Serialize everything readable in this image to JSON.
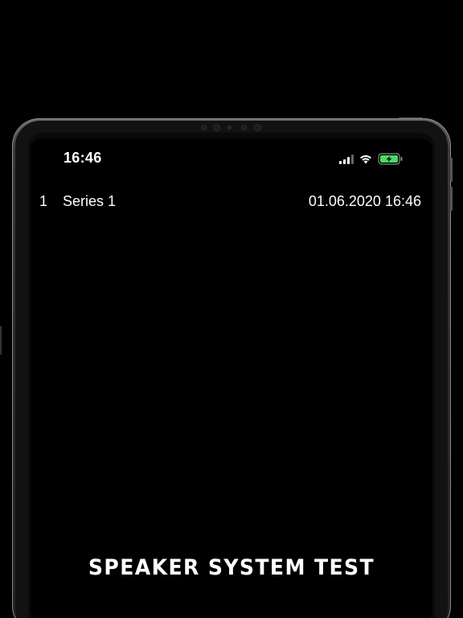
{
  "status_bar": {
    "time": "16:46",
    "signal_icon": "cellular-signal-icon",
    "wifi_icon": "wifi-icon",
    "battery_icon": "battery-charging-icon",
    "battery_color": "#4cd964"
  },
  "series_list": [
    {
      "index": "1",
      "name": "Series 1",
      "date": "01.06.2020 16:46"
    }
  ],
  "app": {
    "title": "SPEAKER SYSTEM TEST"
  },
  "colors": {
    "background": "#000000",
    "text": "#ffffff"
  }
}
